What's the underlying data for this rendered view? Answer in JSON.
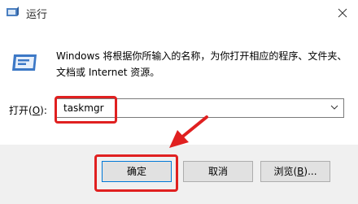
{
  "window": {
    "title": "运行",
    "title_icon": "run-app-icon",
    "close_icon": "close-icon"
  },
  "content": {
    "description": "Windows 将根据你所输入的名称，为你打开相应的程序、文件夹、文档或 Internet 资源。",
    "open_label": "打开(",
    "open_label_mnemonic": "O",
    "open_label_end": "):",
    "open_value": "taskmgr"
  },
  "buttons": {
    "ok_label": "确定",
    "cancel_label": "取消",
    "browse_label": "浏览(",
    "browse_mnemonic": "B",
    "browse_end": ")..."
  },
  "colors": {
    "highlight": "#e02020",
    "arrow": "#e02020",
    "footer_bg": "#f0f0f0"
  }
}
